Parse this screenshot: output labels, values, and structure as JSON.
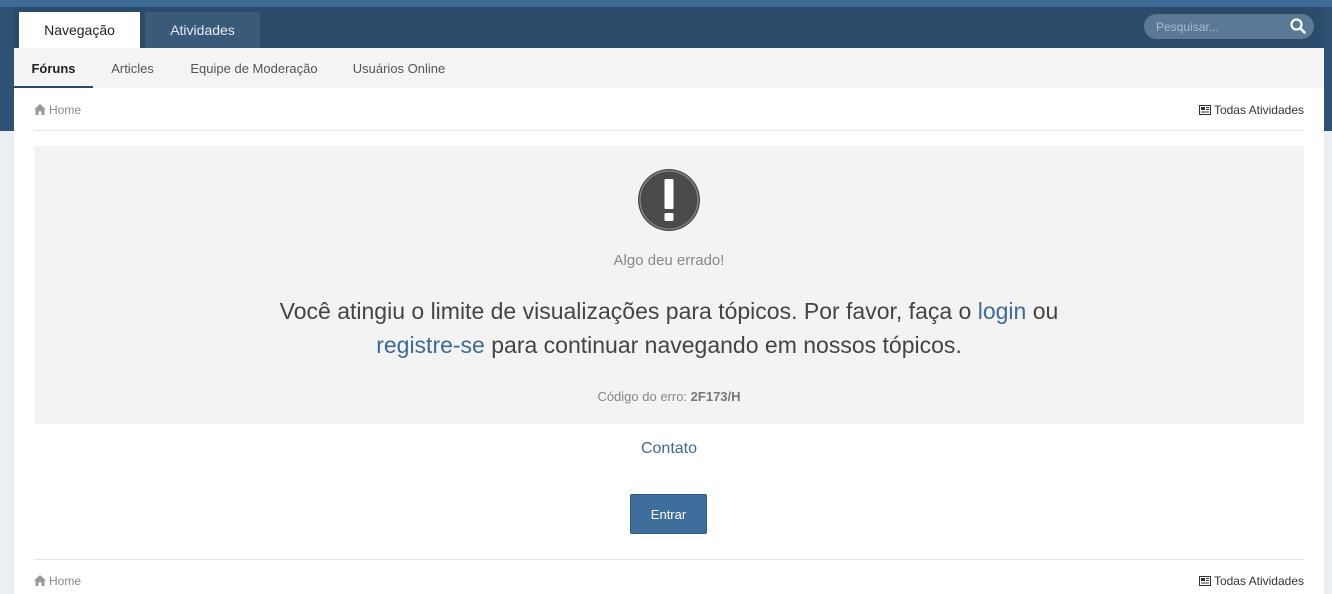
{
  "nav": {
    "tabs": [
      {
        "label": "Navegação",
        "active": true
      },
      {
        "label": "Atividades",
        "active": false
      }
    ],
    "search_placeholder": "Pesquisar..."
  },
  "subnav": {
    "items": [
      {
        "label": "Fóruns",
        "active": true
      },
      {
        "label": "Articles",
        "active": false
      },
      {
        "label": "Equipe de Moderação",
        "active": false
      },
      {
        "label": "Usuários Online",
        "active": false
      }
    ]
  },
  "breadcrumb": {
    "home": "Home",
    "all_activity": "Todas Atividades"
  },
  "error": {
    "title": "Algo deu errado!",
    "message_part1": "Você atingiu o limite de visualizações para tópicos. Por favor, faça o ",
    "login_link": "login",
    "message_part2": " ou ",
    "register_link": "registre-se",
    "message_part3": " para continuar navegando em nossos tópicos.",
    "code_label": "Código do erro: ",
    "code": "2F173/H"
  },
  "contact_link": "Contato",
  "enter_button": "Entrar",
  "colors": {
    "header": "#2b4b6b",
    "accent": "#3d6a97",
    "button": "#3d6e9c"
  },
  "icons": {
    "search": "search-icon",
    "home": "home-icon",
    "activity": "activity-icon",
    "error": "exclamation-icon"
  }
}
